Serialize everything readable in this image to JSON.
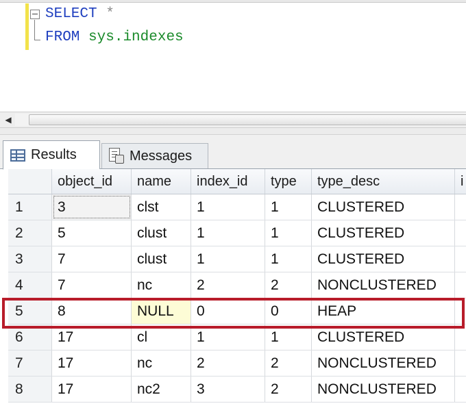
{
  "editor": {
    "line1": {
      "keyword": "SELECT",
      "operator": "*"
    },
    "line2": {
      "keyword": "FROM",
      "object": "sys.indexes"
    }
  },
  "scrollbar": {
    "left_arrow": "◀"
  },
  "tabs": [
    {
      "label": "Results",
      "icon": "grid-icon",
      "selected": true
    },
    {
      "label": "Messages",
      "icon": "messages-icon",
      "selected": false
    }
  ],
  "table": {
    "columns": [
      "object_id",
      "name",
      "index_id",
      "type",
      "type_desc",
      "i"
    ],
    "rows": [
      {
        "num": "1",
        "object_id": "3",
        "name": "clst",
        "index_id": "1",
        "type": "1",
        "type_desc": "CLUSTERED"
      },
      {
        "num": "2",
        "object_id": "5",
        "name": "clust",
        "index_id": "1",
        "type": "1",
        "type_desc": "CLUSTERED"
      },
      {
        "num": "3",
        "object_id": "7",
        "name": "clust",
        "index_id": "1",
        "type": "1",
        "type_desc": "CLUSTERED"
      },
      {
        "num": "4",
        "object_id": "7",
        "name": "nc",
        "index_id": "2",
        "type": "2",
        "type_desc": "NONCLUSTERED"
      },
      {
        "num": "5",
        "object_id": "8",
        "name": "NULL",
        "index_id": "0",
        "type": "0",
        "type_desc": "HEAP"
      },
      {
        "num": "6",
        "object_id": "17",
        "name": "cl",
        "index_id": "1",
        "type": "1",
        "type_desc": "CLUSTERED"
      },
      {
        "num": "7",
        "object_id": "17",
        "name": "nc",
        "index_id": "2",
        "type": "2",
        "type_desc": "NONCLUSTERED"
      },
      {
        "num": "8",
        "object_id": "17",
        "name": "nc2",
        "index_id": "3",
        "type": "2",
        "type_desc": "NONCLUSTERED"
      }
    ]
  },
  "colors": {
    "keyword": "#1f3fbf",
    "object": "#1a8a2a",
    "highlight": "#b81c2a"
  }
}
